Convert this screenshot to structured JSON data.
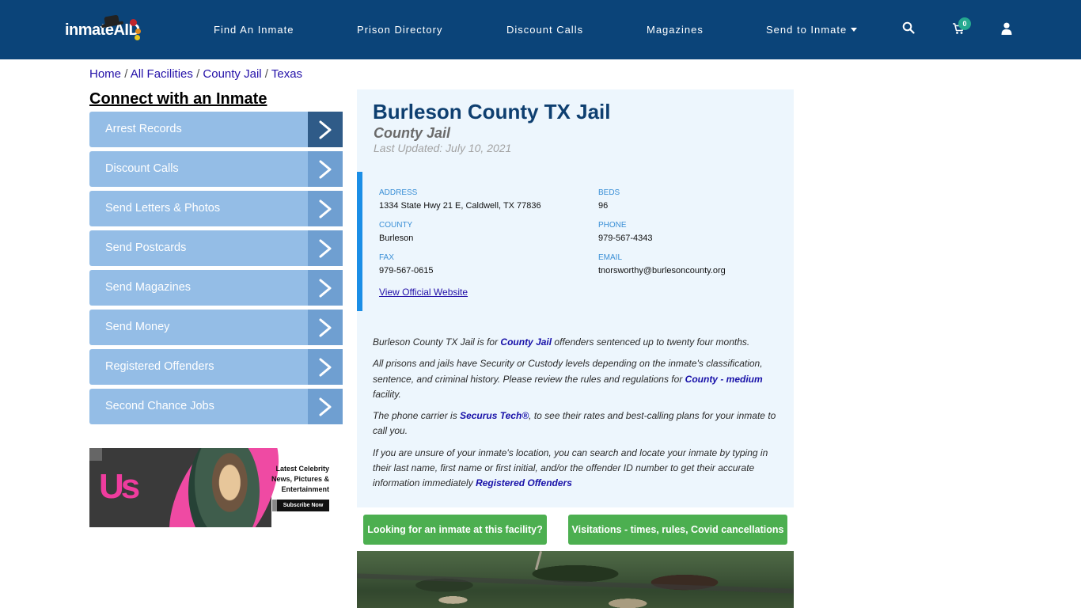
{
  "navbar": {
    "logo_text": "inmateAID",
    "links": [
      {
        "label": "Find An Inmate"
      },
      {
        "label": "Prison Directory"
      },
      {
        "label": "Discount Calls"
      },
      {
        "label": "Magazines"
      },
      {
        "label": "Send to Inmate",
        "has_dropdown": true
      }
    ],
    "icons": [
      "search-icon",
      "cart-icon",
      "user-icon"
    ],
    "cart_count": "0",
    "colors": {
      "background": "#0b4479",
      "badge": "#25a990"
    }
  },
  "breadcrumb": {
    "items": [
      "Home",
      "All Facilities",
      "County Jail",
      "Texas"
    ],
    "separator": "/"
  },
  "sidebar": {
    "title": "Connect with an Inmate",
    "items": [
      {
        "label": "Arrest Records"
      },
      {
        "label": "Discount Calls"
      },
      {
        "label": "Send Letters & Photos"
      },
      {
        "label": "Send Postcards"
      },
      {
        "label": "Send Magazines"
      },
      {
        "label": "Send Money"
      },
      {
        "label": "Registered Offenders"
      },
      {
        "label": "Second Chance Jobs"
      }
    ],
    "ad": {
      "brand": "Us",
      "headline": "Latest Celebrity News, Pictures & Entertainment",
      "cta": "Subscribe Now"
    }
  },
  "facility": {
    "name": "Burleson County TX Jail",
    "type": "County Jail",
    "last_updated": "Last Updated: July 10, 2021",
    "fields": {
      "address": {
        "label": "ADDRESS",
        "value": "1334 State Hwy 21 E, Caldwell, TX 77836"
      },
      "beds": {
        "label": "BEDS",
        "value": "96"
      },
      "county": {
        "label": "COUNTY",
        "value": "Burleson"
      },
      "phone": {
        "label": "PHONE",
        "value": "979-567-4343"
      },
      "fax": {
        "label": "FAX",
        "value": "979-567-0615"
      },
      "email": {
        "label": "EMAIL",
        "value": "tnorsworthy@burlesoncounty.org"
      }
    },
    "website_link": "View Official Website"
  },
  "description": {
    "p1_pre": "Burleson County TX Jail is for ",
    "p1_link": "County Jail",
    "p1_post": " offenders sentenced up to twenty four months.",
    "p2_pre": "All prisons and jails have Security or Custody levels depending on the inmate's classification, sentence, and criminal history. Please review the rules and regulations for ",
    "p2_link": "County - medium",
    "p2_post": " facility.",
    "p3_pre": "The phone carrier is ",
    "p3_link": "Securus Tech®",
    "p3_post": ", to see their rates and best-calling plans for your inmate to call you.",
    "p4_pre": "If you are unsure of your inmate's location, you can search and locate your inmate by typing in their last name, first name or first initial, and/or the offender ID number to get their accurate information immediately ",
    "p4_link": "Registered Offenders"
  },
  "actions": {
    "find_inmate": "Looking for an inmate at this facility?",
    "visitations": "Visitations - times, rules, Covid cancellations"
  }
}
